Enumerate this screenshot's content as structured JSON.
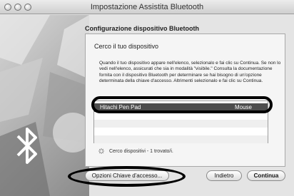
{
  "window": {
    "title": "Impostazione Assistita Bluetooth"
  },
  "heading": "Configurazione dispositivo Bluetooth",
  "panel": {
    "title": "Cerco il tuo dispositivo",
    "instructions": "Quando il tuo dispositivo appare nell'elenco, selezionalo e fai clic su Continua. Se non lo vedi nell'elenco, assicurati che sia in modalità \"visibile.\" Consulta la documentazione fornita con il dispositivo Bluetooth per determinare se hai bisogno di un'opzione determinata della chiave d'accesso. Altrimenti selezionalo e fai clic su Continua."
  },
  "device_list": {
    "items": [
      {
        "name": "Hitachi Pen Pad",
        "type": "Mouse",
        "selected": true
      }
    ]
  },
  "status": {
    "text": "Cerco dispositivi - 1 trovato/i."
  },
  "buttons": {
    "options": "Opzioni Chiave d'accesso...",
    "back": "Indietro",
    "continue": "Continua"
  },
  "icons": {
    "sidebar": "bluetooth-icon",
    "spinner": "spinner-icon"
  },
  "colors": {
    "selection": "#4d4d4d",
    "annotation": "#000000"
  }
}
